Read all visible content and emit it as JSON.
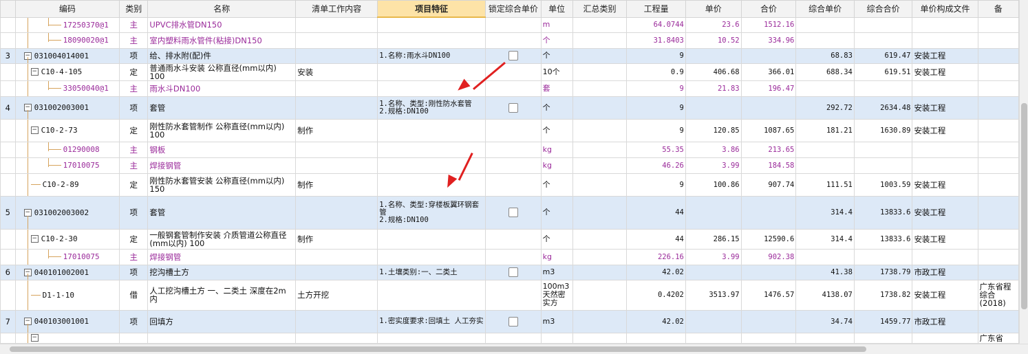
{
  "headers": [
    "",
    "编码",
    "类别",
    "名称",
    "清单工作内容",
    "项目特征",
    "锁定综合单价",
    "单位",
    "汇总类别",
    "工程量",
    "单价",
    "合价",
    "综合单价",
    "综合合价",
    "单价构成文件",
    "备"
  ],
  "rows": [
    {
      "type": "mat",
      "rn": "",
      "code": "17250370@1",
      "cat": "主",
      "name": "UPVC排水管DN150",
      "content": "",
      "feat": "",
      "lock": false,
      "unit": "m",
      "sum": "",
      "qty": "64.0744",
      "price": "23.6",
      "total": "1512.16",
      "cprice": "",
      "ctotal": "",
      "file": "",
      "note": ""
    },
    {
      "type": "mat",
      "rn": "",
      "code": "18090020@1",
      "cat": "主",
      "name": "室内塑料雨水管件(粘接)DN150",
      "content": "",
      "feat": "",
      "lock": false,
      "unit": "个",
      "sum": "",
      "qty": "31.8403",
      "price": "10.52",
      "total": "334.96",
      "cprice": "",
      "ctotal": "",
      "file": "",
      "note": ""
    },
    {
      "type": "item",
      "rn": "3",
      "code": "031004014001",
      "cat": "项",
      "name": "给、排水附(配)件",
      "content": "",
      "feat": "1.名称:雨水斗DN100",
      "lock": true,
      "unit": "个",
      "sum": "",
      "qty": "9",
      "price": "",
      "total": "",
      "cprice": "68.83",
      "ctotal": "619.47",
      "file": "安装工程",
      "note": ""
    },
    {
      "type": "sub",
      "rn": "",
      "code": "C10-4-105",
      "cat": "定",
      "name": "普通雨水斗安装 公称直径(mm以内) 100",
      "content": "安装",
      "feat": "",
      "lock": false,
      "unit": "10个",
      "sum": "",
      "qty": "0.9",
      "price": "406.68",
      "total": "366.01",
      "cprice": "688.34",
      "ctotal": "619.51",
      "file": "安装工程",
      "note": ""
    },
    {
      "type": "mat",
      "rn": "",
      "code": "33050040@1",
      "cat": "主",
      "name": "雨水斗DN100",
      "content": "",
      "feat": "",
      "lock": false,
      "unit": "套",
      "sum": "",
      "qty": "9",
      "price": "21.83",
      "total": "196.47",
      "cprice": "",
      "ctotal": "",
      "file": "",
      "note": ""
    },
    {
      "type": "item",
      "rn": "4",
      "code": "031002003001",
      "cat": "项",
      "name": "套管",
      "content": "",
      "feat": "1.名称、类型:刚性防水套管\n2.规格:DN100",
      "lock": true,
      "unit": "个",
      "sum": "",
      "qty": "9",
      "price": "",
      "total": "",
      "cprice": "292.72",
      "ctotal": "2634.48",
      "file": "安装工程",
      "note": ""
    },
    {
      "type": "sub",
      "rn": "",
      "code": "C10-2-73",
      "cat": "定",
      "name": "刚性防水套管制作 公称直径(mm以内) 100",
      "content": "制作",
      "feat": "",
      "lock": false,
      "unit": "个",
      "sum": "",
      "qty": "9",
      "price": "120.85",
      "total": "1087.65",
      "cprice": "181.21",
      "ctotal": "1630.89",
      "file": "安装工程",
      "note": ""
    },
    {
      "type": "mat",
      "rn": "",
      "code": "01290008",
      "cat": "主",
      "name": "钢板",
      "content": "",
      "feat": "",
      "lock": false,
      "unit": "kg",
      "sum": "",
      "qty": "55.35",
      "price": "3.86",
      "total": "213.65",
      "cprice": "",
      "ctotal": "",
      "file": "",
      "note": ""
    },
    {
      "type": "mat",
      "rn": "",
      "code": "17010075",
      "cat": "主",
      "name": "焊接钢管",
      "content": "",
      "feat": "",
      "lock": false,
      "unit": "kg",
      "sum": "",
      "qty": "46.26",
      "price": "3.99",
      "total": "184.58",
      "cprice": "",
      "ctotal": "",
      "file": "",
      "note": ""
    },
    {
      "type": "sub",
      "rn": "",
      "code": "C10-2-89",
      "cat": "定",
      "name": "刚性防水套管安装 公称直径(mm以内) 150",
      "content": "制作",
      "feat": "",
      "lock": false,
      "unit": "个",
      "sum": "",
      "qty": "9",
      "price": "100.86",
      "total": "907.74",
      "cprice": "111.51",
      "ctotal": "1003.59",
      "file": "安装工程",
      "note": ""
    },
    {
      "type": "item",
      "rn": "5",
      "code": "031002003002",
      "cat": "项",
      "name": "套管",
      "content": "",
      "feat": "1.名称、类型:穿楼板翼环钢套管\n2.规格:DN100",
      "lock": true,
      "unit": "个",
      "sum": "",
      "qty": "44",
      "price": "",
      "total": "",
      "cprice": "314.4",
      "ctotal": "13833.6",
      "file": "安装工程",
      "note": ""
    },
    {
      "type": "sub",
      "rn": "",
      "code": "C10-2-30",
      "cat": "定",
      "name": "一般钢套管制作安装 介质管道公称直径(mm以内) 100",
      "content": "制作",
      "feat": "",
      "lock": false,
      "unit": "个",
      "sum": "",
      "qty": "44",
      "price": "286.15",
      "total": "12590.6",
      "cprice": "314.4",
      "ctotal": "13833.6",
      "file": "安装工程",
      "note": ""
    },
    {
      "type": "mat",
      "rn": "",
      "code": "17010075",
      "cat": "主",
      "name": "焊接钢管",
      "content": "",
      "feat": "",
      "lock": false,
      "unit": "kg",
      "sum": "",
      "qty": "226.16",
      "price": "3.99",
      "total": "902.38",
      "cprice": "",
      "ctotal": "",
      "file": "",
      "note": ""
    },
    {
      "type": "item",
      "rn": "6",
      "code": "040101002001",
      "cat": "项",
      "name": "挖沟槽土方",
      "content": "",
      "feat": "1.土壤类别:一、二类土",
      "lock": true,
      "unit": "m3",
      "sum": "",
      "qty": "42.02",
      "price": "",
      "total": "",
      "cprice": "41.38",
      "ctotal": "1738.79",
      "file": "市政工程",
      "note": ""
    },
    {
      "type": "sub",
      "rn": "",
      "code": "D1-1-10",
      "cat": "借",
      "name": "人工挖沟槽土方 一、二类土 深度在2m内",
      "content": "土方开挖",
      "feat": "",
      "lock": false,
      "unit": "100m3天然密实方",
      "sum": "",
      "qty": "0.4202",
      "price": "3513.97",
      "total": "1476.57",
      "cprice": "4138.07",
      "ctotal": "1738.82",
      "file": "安装工程",
      "note": "广东省程综合(2018)"
    },
    {
      "type": "item",
      "rn": "7",
      "code": "040103001001",
      "cat": "项",
      "name": "回填方",
      "content": "",
      "feat": "1.密实度要求:回填土 人工夯实",
      "lock": true,
      "unit": "m3",
      "sum": "",
      "qty": "42.02",
      "price": "",
      "total": "",
      "cprice": "34.74",
      "ctotal": "1459.77",
      "file": "市政工程",
      "note": ""
    },
    {
      "type": "sub",
      "rn": "",
      "code": "",
      "cat": "",
      "name": "",
      "content": "",
      "feat": "",
      "lock": false,
      "unit": "",
      "sum": "",
      "qty": "",
      "price": "",
      "total": "",
      "cprice": "",
      "ctotal": "",
      "file": "",
      "note": "广东省"
    }
  ],
  "colors": {
    "item_bg": "#dde9f7",
    "material_text": "#9a2a9a",
    "highlight_header": "#fde3a7",
    "arrow": "#e02020"
  }
}
